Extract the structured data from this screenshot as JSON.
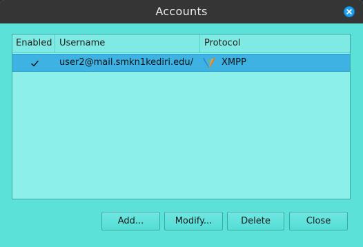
{
  "window": {
    "title": "Accounts"
  },
  "table": {
    "headers": {
      "enabled": "Enabled",
      "username": "Username",
      "protocol": "Protocol"
    },
    "rows": [
      {
        "enabled": true,
        "username": "user2@mail.smkn1kediri.edu/",
        "protocol": "XMPP",
        "protocol_icon": "xmpp-logo-icon"
      }
    ]
  },
  "buttons": {
    "add": "Add...",
    "modify": "Modify...",
    "delete": "Delete",
    "close": "Close"
  },
  "colors": {
    "window_bg": "#5ce1d9",
    "titlebar": "#353535",
    "selection": "#3db2e3",
    "close_accent": "#1da1f2"
  }
}
